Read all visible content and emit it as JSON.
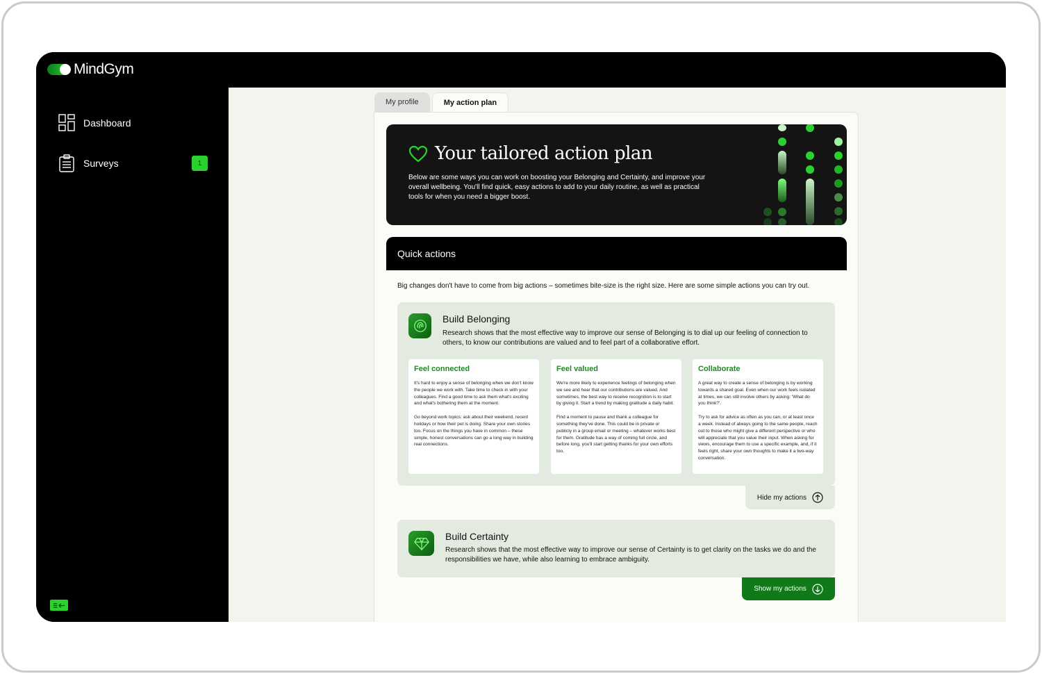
{
  "brand": {
    "name": "MindGym",
    "accent": "#2bd12f",
    "dark_green": "#0f7a17"
  },
  "sidebar": {
    "items": [
      {
        "label": "Dashboard",
        "icon": "dashboard-icon"
      },
      {
        "label": "Surveys",
        "icon": "clipboard-icon",
        "badge": "1"
      }
    ],
    "collapse_icon": "collapse-sidebar-icon"
  },
  "tabs": [
    {
      "label": "My profile",
      "active": false
    },
    {
      "label": "My action plan",
      "active": true
    }
  ],
  "hero": {
    "title": "Your tailored action plan",
    "text": "Below are some ways you can work on boosting your Belonging and Certainty, and improve your overall wellbeing. You'll find quick, easy actions to add to your daily routine, as well as practical tools for when you need a bigger boost.",
    "icon": "heart-icon"
  },
  "quick_actions": {
    "header": "Quick actions",
    "intro": "Big changes don't have to come from big actions – sometimes bite-size is the right size. Here are some simple actions you can try out.",
    "cards": [
      {
        "title": "Build Belonging",
        "icon": "fingerprint-icon",
        "description": "Research shows that the most effective way to improve our sense of Belonging is to dial up our feeling of connection to others, to know our contributions are valued and to feel part of a collaborative effort.",
        "actions": [
          {
            "title": "Feel connected",
            "p1": "It's hard to enjoy a sense of belonging when we don't know the people we work with. Take time to check in with your colleagues. Find a good time to ask them what's exciting and what's bothering them at the moment.",
            "p2": "Go beyond work topics: ask about their weekend, recent holidays or how their pet is doing. Share your own stories too. Focus on the things you have in common – these simple, honest conversations can go a long way in building real connections."
          },
          {
            "title": "Feel valued",
            "p1": "We're more likely to experience feelings of belonging when we see and hear that our contributions are valued. And sometimes, the best way to receive recognition is to start by giving it. Start a trend by making gratitude a daily habit.",
            "p2": "Find a moment to pause and thank a colleague for something they've done. This could be in private or publicly in a group email or meeting – whatever works best for them. Gratitude has a way of coming full circle, and before long, you'll start getting thanks for your own efforts too."
          },
          {
            "title": "Collaborate",
            "p1": "A great way to create a sense of belonging is by working towards a shared goal. Even when our work feels isolated at times, we can still involve others by asking: 'What do you think?'.",
            "p2": "Try to ask for advice as often as you can, or at least once a week. Instead of always going to the same people, reach out to those who might give a different perspective or who will appreciate that you value their input. When asking for views, encourage them to use a specific example, and, if it feels right, share your own thoughts to make it a two-way conversation."
          }
        ],
        "toggle_label": "Hide my actions"
      },
      {
        "title": "Build Certainty",
        "icon": "gem-icon",
        "description": "Research shows that the most effective way to improve our sense of Certainty is to get clarity on the tasks we do and the responsibilities we have, while also learning to embrace ambiguity.",
        "toggle_label": "Show my actions"
      }
    ]
  }
}
